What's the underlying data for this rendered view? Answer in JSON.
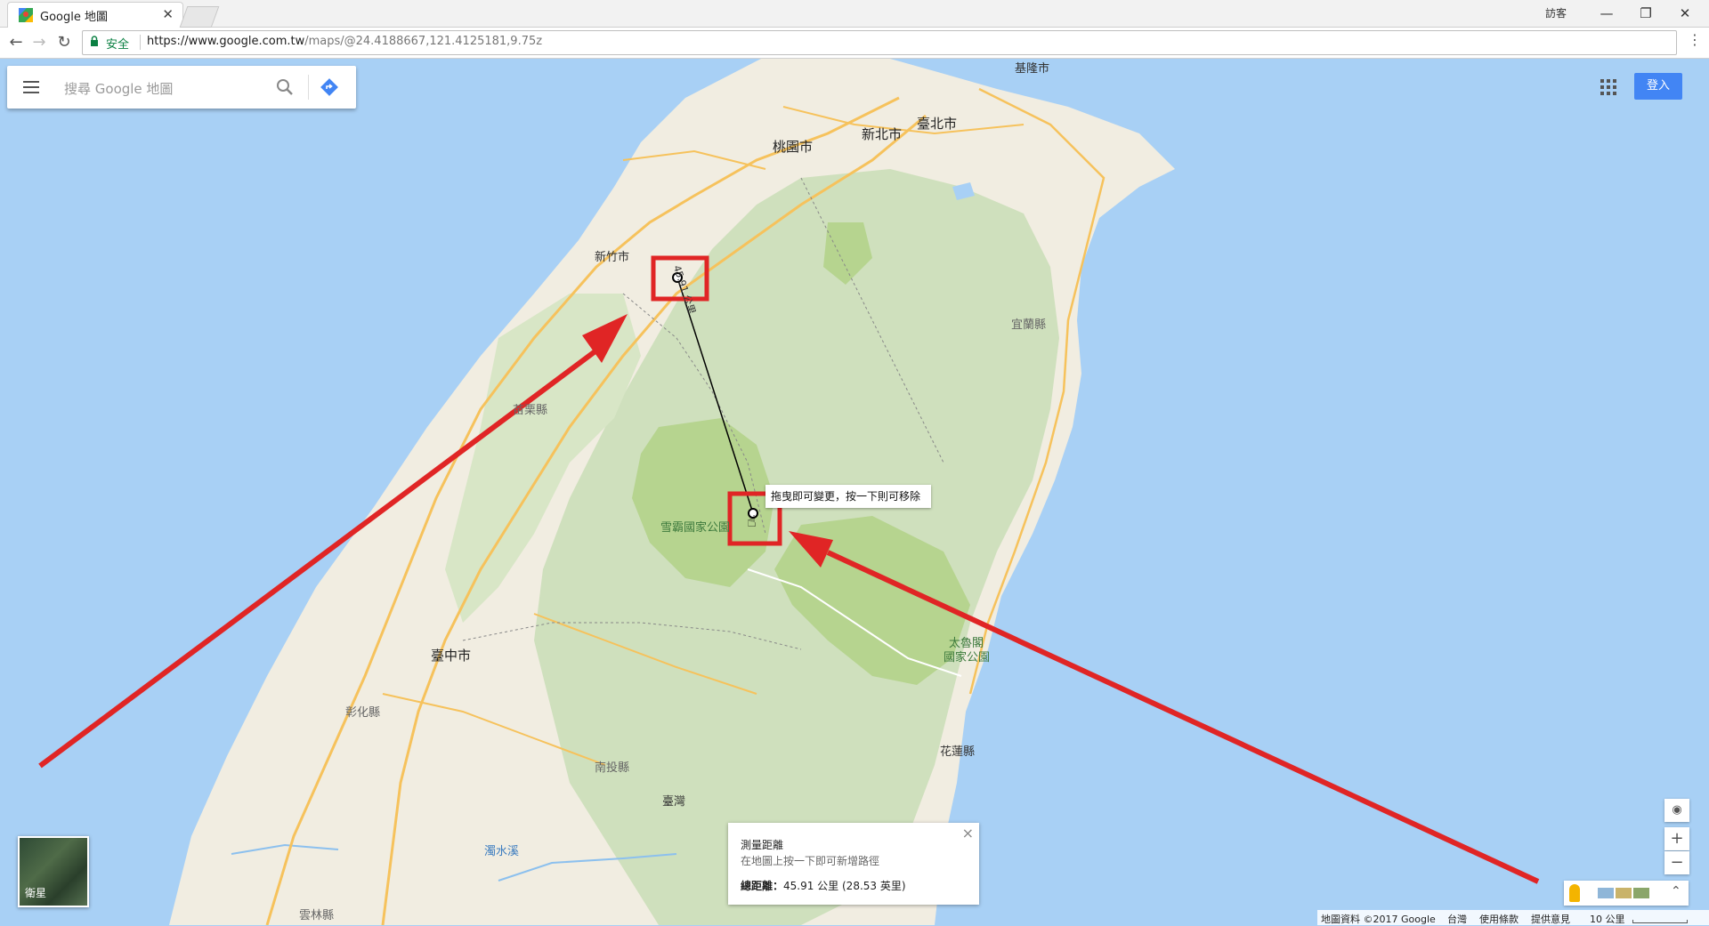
{
  "browser": {
    "tab_title": "Google 地圖",
    "user_label": "訪客",
    "secure_label": "安全",
    "url_host": "https://www.google.com.tw",
    "url_path": "/maps/@24.4188667,121.4125181,9.75z"
  },
  "search": {
    "placeholder": "搜尋 Google 地圖"
  },
  "header": {
    "signin_label": "登入"
  },
  "map_labels": {
    "keelung": "基隆市",
    "taipei": "臺北市",
    "new_taipei": "新北市",
    "taoyuan": "桃園市",
    "hsinchu": "新竹市",
    "yilan": "宜蘭縣",
    "miaoli": "苗栗縣",
    "shei_pa": "雪霸國家公園",
    "taichung": "臺中市",
    "taroko_1": "太魯閣",
    "taroko_2": "國家公園",
    "changhua": "彰化縣",
    "nantou": "南投縣",
    "taiwan": "臺灣",
    "hualien": "花蓮縣",
    "zhuoshui": "濁水溪",
    "yunlin": "雲林縣",
    "distance_label": "45.91 公里"
  },
  "tooltip": {
    "text": "拖曳即可變更，按一下則可移除"
  },
  "measure": {
    "title": "測量距離",
    "hint": "在地圖上按一下即可新增路徑",
    "total_label": "總距離：",
    "total_value": "45.91 公里 (28.53 英里)"
  },
  "satellite": {
    "label": "衛星"
  },
  "attribution": {
    "data": "地圖資料 ©2017 Google",
    "region": "台灣",
    "terms": "使用條款",
    "feedback": "提供意見",
    "scale": "10 公里"
  },
  "colors": {
    "ocean": "#a8d0f5",
    "land": "#f1ede1",
    "forest": "#cfe0bd",
    "park": "#b6d48f",
    "road": "#f6c25c",
    "annotation_red": "#e02525",
    "signin_blue": "#4285f4"
  }
}
